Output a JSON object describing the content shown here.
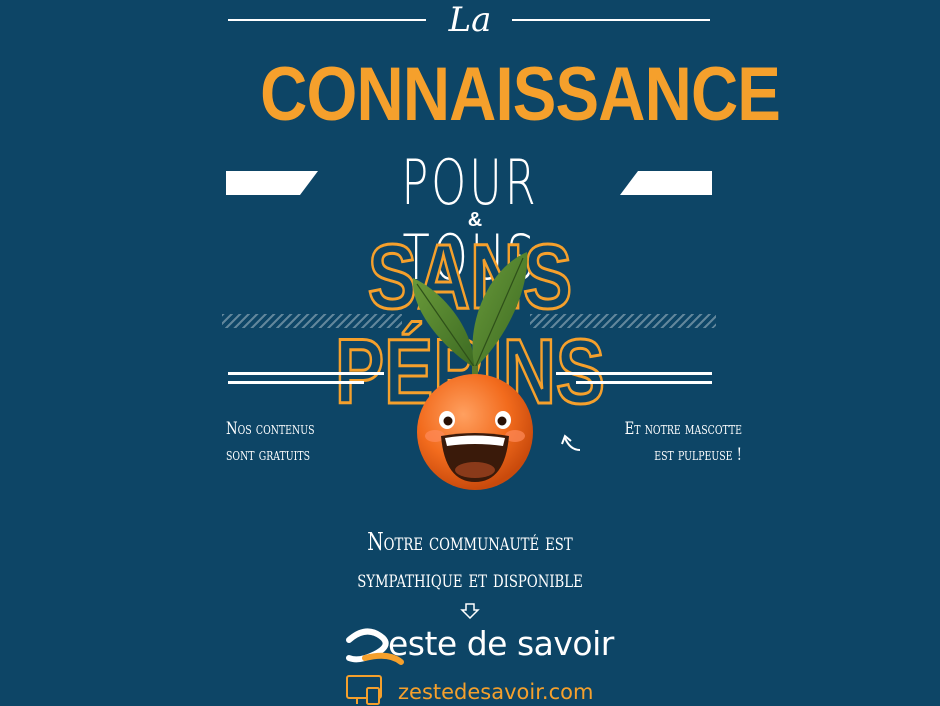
{
  "poster": {
    "article": "La",
    "headline": "CONNAISSANCE",
    "subline": "POUR TOUS",
    "ampersand": "&",
    "headline2": "SANS PÉPINS",
    "caption_left_1": "Nos contenus",
    "caption_left_2": "sont gratuits",
    "caption_right_1": "Et notre mascotte",
    "caption_right_2": "est pulpeuse !",
    "community_1": "Notre communauté est",
    "community_2": "sympathique et disponible",
    "brand": "este de savoir",
    "url": "zestedesavoir.com"
  },
  "colors": {
    "background": "#0d4566",
    "accent": "#f5a02c",
    "text": "#ffffff"
  },
  "icons": [
    "clementine-mascot",
    "curved-arrow-icon",
    "down-arrow-icon",
    "zds-logo-icon",
    "devices-icon"
  ]
}
